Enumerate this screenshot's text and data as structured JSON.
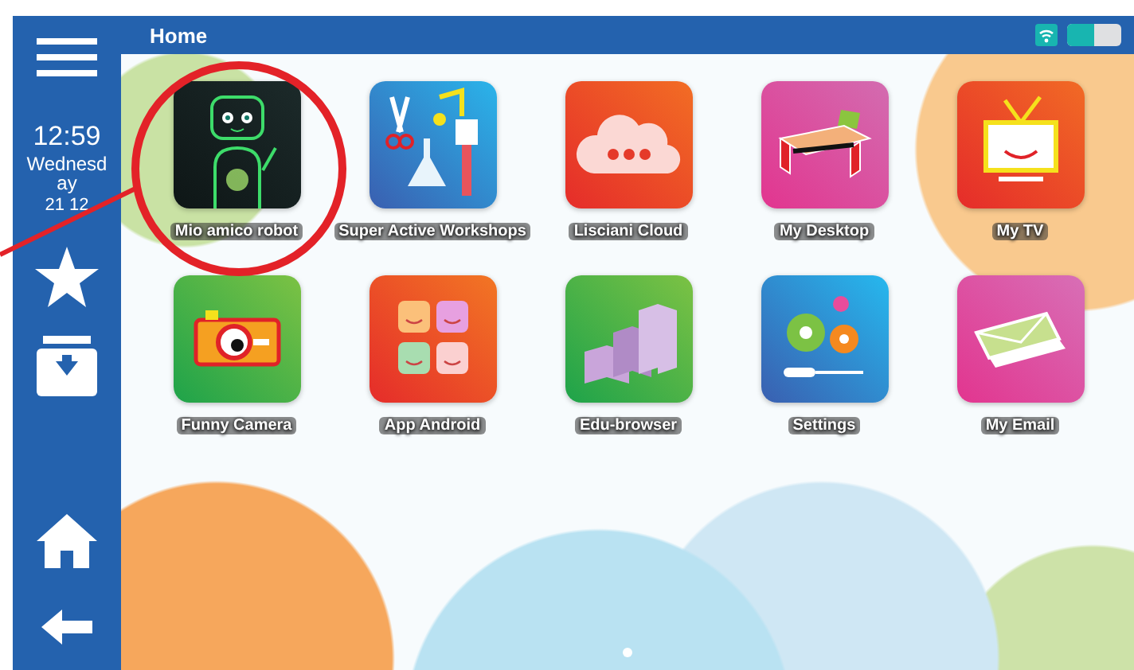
{
  "sidebar": {
    "time": "12:59",
    "day": "Wednesday",
    "date": "21 12"
  },
  "header": {
    "title": "Home"
  },
  "apps": [
    {
      "label": "Mio amico robot"
    },
    {
      "label": "Super Active Workshops"
    },
    {
      "label": "Lisciani Cloud"
    },
    {
      "label": "My Desktop"
    },
    {
      "label": "My TV"
    },
    {
      "label": "Funny Camera"
    },
    {
      "label": "App Android"
    },
    {
      "label": "Edu-browser"
    },
    {
      "label": "Settings"
    },
    {
      "label": "My Email"
    }
  ],
  "pager": [
    {
      "selected": true
    }
  ]
}
